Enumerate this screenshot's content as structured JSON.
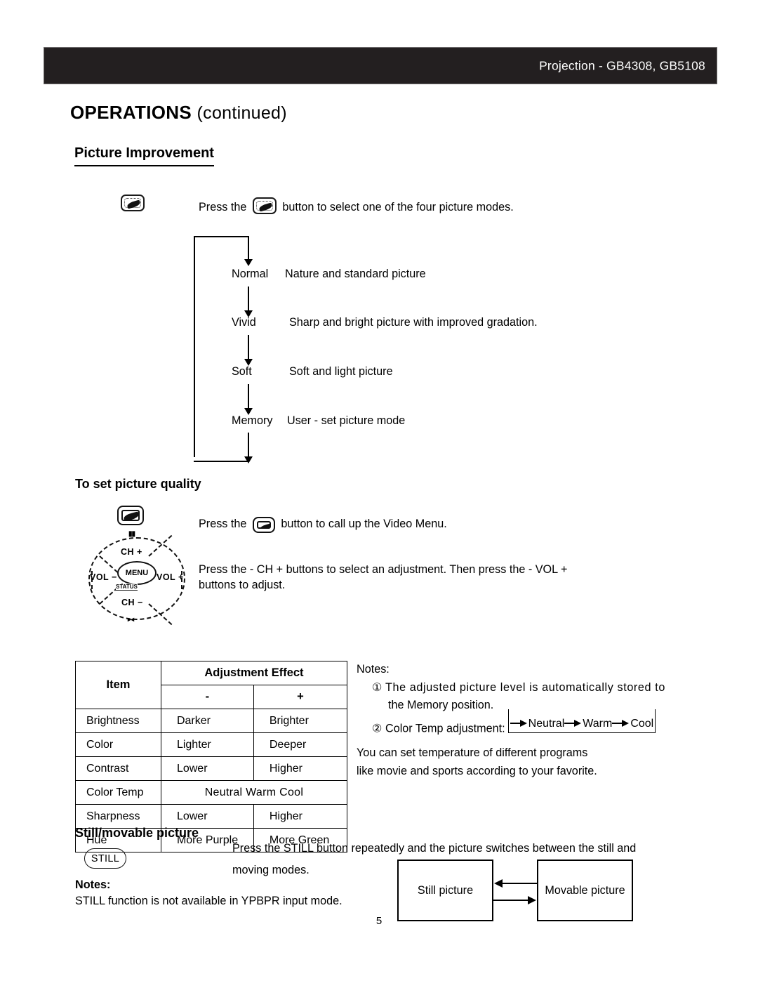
{
  "header": {
    "title": "Projection - GB4308, GB5108"
  },
  "section": {
    "ops_title": "OPERATIONS",
    "ops_continued": "(continued)",
    "picture_improvement": "Picture Improvement"
  },
  "picture_mode": {
    "instruction_before": "Press the ",
    "instruction_after": " button to select one of the four picture modes.",
    "icon_name": "picture-mode-icon",
    "modes": [
      {
        "name": "Normal",
        "desc": "Nature and standard picture"
      },
      {
        "name": "Vivid",
        "desc": "Sharp and bright picture with improved gradation."
      },
      {
        "name": "Soft",
        "desc": "Soft and light picture"
      },
      {
        "name": "Memory",
        "desc": "User - set picture mode"
      }
    ]
  },
  "picture_quality": {
    "heading": "To set picture quality",
    "menu_instruction_before": "Press the ",
    "menu_instruction_after": " button to call up the Video Menu.",
    "adjust_instruction": "Press the - CH + buttons to select an adjustment. Then press the - VOL +\nbuttons to adjust.",
    "remote": {
      "ch_up": "CH +",
      "ch_down": "CH −",
      "vol_minus": "VOL −",
      "vol_plus": "VOL +",
      "menu": "MENU",
      "status": "STATUS",
      "tick_top": "▮▮",
      "tick_bottom": "▸◂"
    }
  },
  "table": {
    "header_item": "Item",
    "header_effect": "Adjustment Effect",
    "header_minus": "-",
    "header_plus": "+",
    "rows": [
      {
        "item": "Brightness",
        "minus": "Darker",
        "plus": "Brighter"
      },
      {
        "item": "Color",
        "minus": "Lighter",
        "plus": "Deeper"
      },
      {
        "item": "Contrast",
        "minus": "Lower",
        "plus": "Higher"
      },
      {
        "item": "Color Temp",
        "span": "Neutral     Warm     Cool"
      },
      {
        "item": "Sharpness",
        "minus": "Lower",
        "plus": "Higher"
      },
      {
        "item": "Hue",
        "minus": "More Purple",
        "plus": "More Green"
      }
    ]
  },
  "notes": {
    "label": "Notes:",
    "item1_marker": "①",
    "item1_line1": "The adjusted picture level is automatically stored to",
    "item1_line2": "the  Memory position.",
    "item2_marker": "②",
    "item2_text": "Color Temp adjustment:",
    "ct_neutral": "Neutral",
    "ct_warm": "Warm",
    "ct_cool": "Cool",
    "tail_line1": "You  can  set  temperature  of  different  programs",
    "tail_line2": "like movie and sports according to your favorite."
  },
  "still": {
    "heading": "Still/movable picture",
    "button_label": "STILL",
    "instruction_line1": "Press the STILL button repeatedly and the picture switches between the still and",
    "instruction_line2": "moving modes.",
    "notes_label": "Notes:",
    "notes_text": "STILL function is not available in YPBPR input mode.",
    "box_still": "Still picture",
    "box_movable": "Movable picture"
  },
  "footer": {
    "page_number": "5"
  }
}
